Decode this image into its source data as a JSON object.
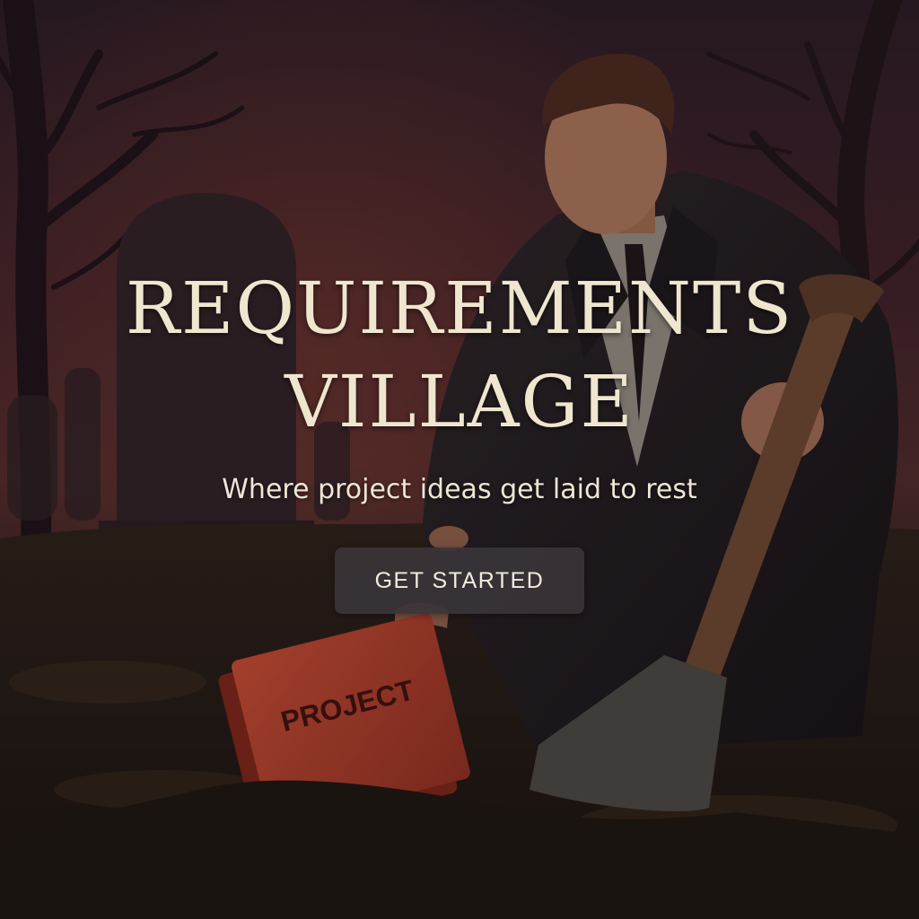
{
  "hero": {
    "title_line1": "REQUIREMENTS",
    "title_line2": "VILLAGE",
    "subtitle": "Where project ideas get laid to rest",
    "cta_label": "GET STARTED"
  },
  "illustration": {
    "book_label": "PROJECT"
  },
  "colors": {
    "title": "#efe6cf",
    "button_bg": "#3a3438",
    "sky_glow": "#7a3a2c",
    "book": "#b8432e"
  }
}
